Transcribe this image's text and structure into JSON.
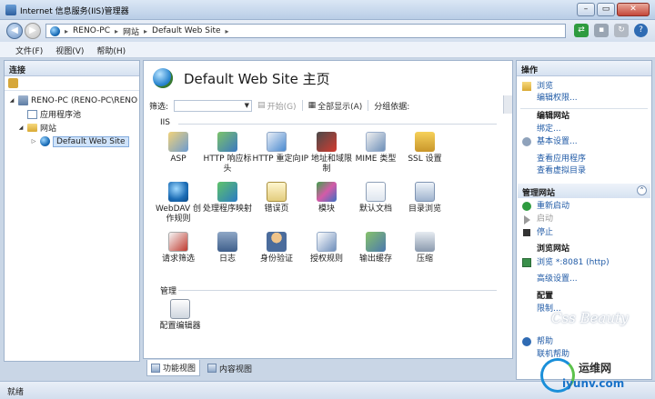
{
  "window": {
    "title": "Internet 信息服务(IIS)管理器"
  },
  "address": {
    "crumbs": [
      "RENO-PC",
      "网站",
      "Default Web Site"
    ]
  },
  "menu": {
    "items": [
      "文件(F)",
      "视图(V)",
      "帮助(H)"
    ]
  },
  "connections": {
    "header": "连接",
    "tree": [
      {
        "label": "RENO-PC (RENO-PC\\RENO",
        "level": 0,
        "expanded": true
      },
      {
        "label": "应用程序池",
        "level": 1
      },
      {
        "label": "网站",
        "level": 1,
        "expanded": true
      },
      {
        "label": "Default Web Site",
        "level": 2,
        "selected": true
      }
    ]
  },
  "main": {
    "title": "Default Web Site 主页",
    "filter": {
      "label": "筛选:",
      "start_label": "开始(G)",
      "show_all_label": "全部显示(A)",
      "group_by_label": "分组依据:"
    },
    "groups": [
      {
        "name": "IIS",
        "features": [
          {
            "label": "ASP",
            "icon": "asp-icon"
          },
          {
            "label": "HTTP 响应标头",
            "icon": "http-response-headers-icon"
          },
          {
            "label": "HTTP 重定向",
            "icon": "http-redirect-icon"
          },
          {
            "label": "IP 地址和域限制",
            "icon": "ip-domain-restrictions-icon"
          },
          {
            "label": "MIME 类型",
            "icon": "mime-types-icon"
          },
          {
            "label": "SSL 设置",
            "icon": "ssl-lock-icon"
          },
          {
            "label": "WebDAV 创作规则",
            "icon": "webdav-globe-icon"
          },
          {
            "label": "处理程序映射",
            "icon": "handler-mappings-icon"
          },
          {
            "label": "错误页",
            "icon": "error-pages-icon"
          },
          {
            "label": "模块",
            "icon": "modules-icon"
          },
          {
            "label": "默认文档",
            "icon": "default-document-icon"
          },
          {
            "label": "目录浏览",
            "icon": "directory-browsing-icon"
          },
          {
            "label": "请求筛选",
            "icon": "request-filtering-icon"
          },
          {
            "label": "日志",
            "icon": "logging-icon"
          },
          {
            "label": "身份验证",
            "icon": "authentication-icon"
          },
          {
            "label": "授权规则",
            "icon": "authorization-rules-icon"
          },
          {
            "label": "输出缓存",
            "icon": "output-caching-icon"
          },
          {
            "label": "压缩",
            "icon": "compression-icon"
          }
        ]
      },
      {
        "name": "管理",
        "features": [
          {
            "label": "配置编辑器",
            "icon": "configuration-editor-icon"
          }
        ]
      }
    ],
    "view_tabs": [
      "功能视图",
      "内容视图"
    ]
  },
  "actions": {
    "header": "操作",
    "browse": "浏览",
    "edit_permissions": "编辑权限...",
    "edit_site_title": "编辑网站",
    "bindings": "绑定...",
    "basic_settings": "基本设置...",
    "view_apps": "查看应用程序",
    "view_vdirs": "查看虚拟目录",
    "manage_site_title": "管理网站",
    "restart": "重新启动",
    "start": "启动",
    "stop": "停止",
    "browse_site_title": "浏览网站",
    "browse_port": "浏览 *:8081 (http)",
    "advanced_settings": "高级设置...",
    "config_title": "配置",
    "limits": "限制...",
    "help_label": "帮助",
    "online_help": "联机帮助"
  },
  "status": {
    "text": "就绪"
  },
  "watermark": {
    "script": "Css Beauty",
    "site": "运维网",
    "url": "iyunv.com"
  }
}
